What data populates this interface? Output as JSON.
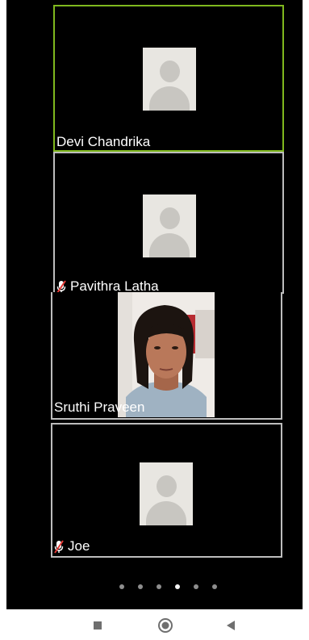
{
  "meeting": {
    "participants": [
      {
        "name": "Devi Chandrika",
        "muted": false,
        "active_speaker": true,
        "video": false
      },
      {
        "name": "Pavithra Latha",
        "muted": true,
        "active_speaker": false,
        "video": false
      },
      {
        "name": "Sruthi Praveen",
        "muted": false,
        "active_speaker": false,
        "video": true
      },
      {
        "name": "Joe",
        "muted": true,
        "active_speaker": false,
        "video": false
      }
    ],
    "pagination": {
      "total_pages": 6,
      "current_page": 4
    }
  },
  "nav_bar": {
    "recents_icon": "square-icon",
    "home_icon": "circle-icon",
    "back_icon": "triangle-left-icon"
  },
  "colors": {
    "background": "#000000",
    "active_speaker_border": "#7fb81e",
    "tile_border": "#bdbdbd",
    "muted_mic": "#e53935",
    "avatar_bg": "#e8e6e1",
    "avatar_fg": "#c8c6c1"
  }
}
